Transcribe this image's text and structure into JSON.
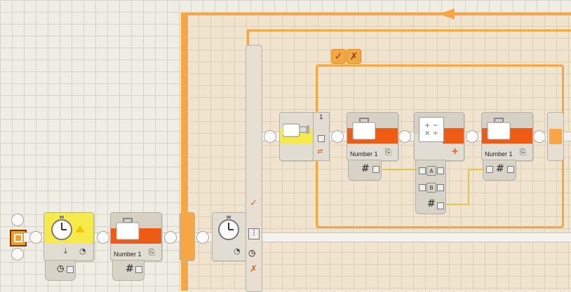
{
  "palette": {
    "canvas_bg": "#efede4",
    "loop_line": "#f6a642",
    "variable_orange": "#ef5b12",
    "wait_yellow": "#f6ea4a",
    "data_wire": "#e8c24e",
    "beam": "#f4f3ef"
  },
  "program": {
    "blocks": [
      {
        "id": "wait-timer-1",
        "type": "wait-timer",
        "icon": "stopwatch-icon"
      },
      {
        "id": "variable-1",
        "type": "variable",
        "label": "Number 1",
        "icon": "briefcase-icon"
      },
      {
        "id": "loop",
        "type": "loop",
        "icon": "stopwatch-icon"
      },
      {
        "id": "switch",
        "type": "switch",
        "icons": [
          "check-icon",
          "cross-icon"
        ]
      },
      {
        "id": "touch-sensor",
        "type": "touch-sensor",
        "port": "1",
        "icon": "touch-sensor-icon"
      },
      {
        "id": "variable-2",
        "type": "variable",
        "label": "Number 1",
        "icon": "briefcase-icon"
      },
      {
        "id": "math",
        "type": "math",
        "icon": "math-icon",
        "plugs": [
          "A",
          "B"
        ]
      },
      {
        "id": "variable-3",
        "type": "variable",
        "label": "Number 1",
        "icon": "briefcase-icon"
      }
    ],
    "touch_port": "1",
    "variable_label": "Number 1",
    "plug_a": "A",
    "plug_b": "B",
    "hash_symbol": "#"
  }
}
